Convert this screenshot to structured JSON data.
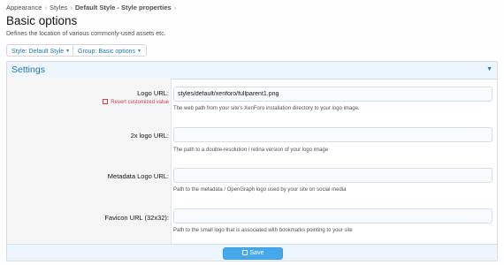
{
  "breadcrumb": [
    "Appearance",
    "Styles",
    "Default Style - Style properties"
  ],
  "page": {
    "title": "Basic options",
    "description": "Defines the location of various commonly-used assets etc."
  },
  "filters": {
    "style_label": "Style: Default Style",
    "group_label": "Group: Basic options"
  },
  "section": {
    "title": "Settings"
  },
  "fields": [
    {
      "label": "Logo URL:",
      "revert_label": "Revert customized value",
      "value": "styles/default/xenforo/fullparent1.png",
      "hint": "The web path from your site's XenForo installation directory to your logo image."
    },
    {
      "label": "2x logo URL:",
      "value": "",
      "hint": "The path to a double-resolution / retina version of your logo image"
    },
    {
      "label": "Metadata Logo URL:",
      "value": "",
      "hint": "Path to the metadata / OpenGraph logo used by your site on social media"
    },
    {
      "label": "Favicon URL (32x32):",
      "value": "",
      "hint": "Path to the small logo that is associated with bookmarks pointing to your site"
    }
  ],
  "actions": {
    "save_label": "Save"
  },
  "icons": {
    "collapse": "chevron-down-icon",
    "save": "save-icon",
    "revert": "checkbox-icon"
  },
  "colors": {
    "accent": "#2577b1",
    "button": "#47a7eb",
    "header_bg": "#edf6fd",
    "revert": "#c84448"
  }
}
